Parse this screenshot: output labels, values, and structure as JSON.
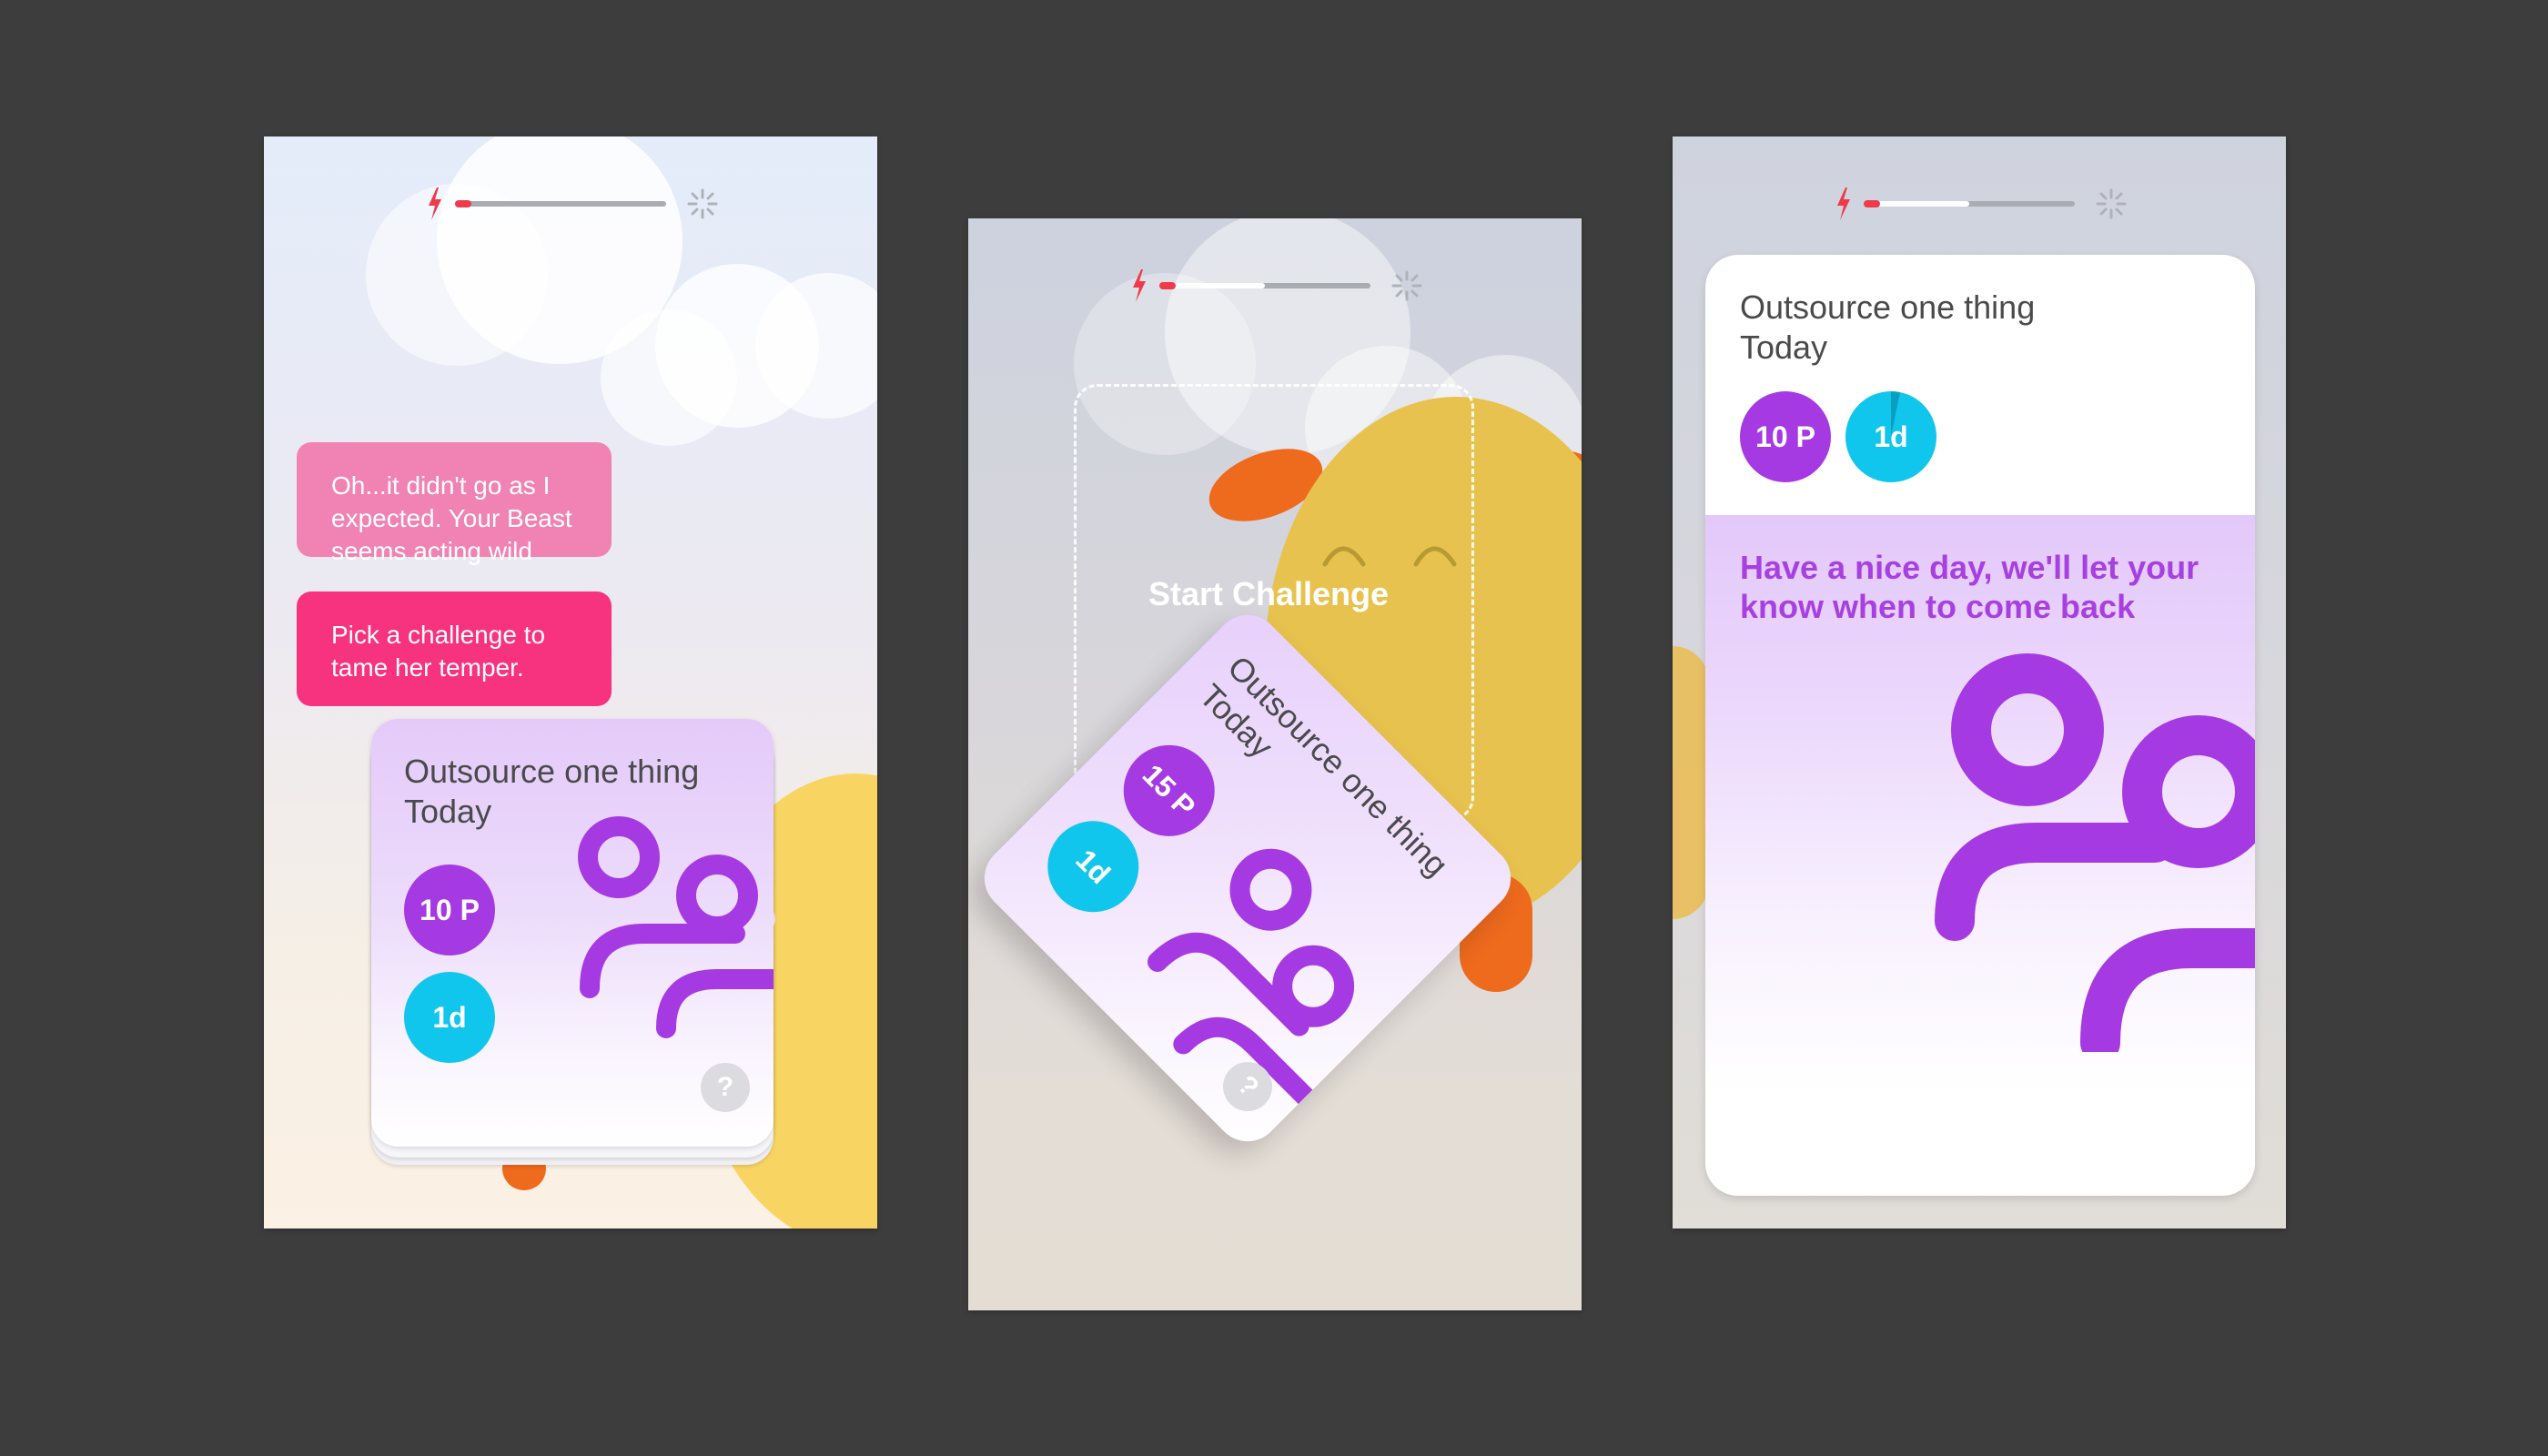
{
  "colors": {
    "background": "#3d3d3d",
    "bubble_light_pink": "#f083b3",
    "bubble_hot_pink": "#f7327f",
    "badge_purple": "#a53ae3",
    "badge_cyan": "#11c6ec",
    "text_purple": "#a740e0",
    "beast_yellow": "#e8c24e",
    "beast_orange": "#ee6a1d",
    "energy_red": "#ee3a4a"
  },
  "icons": [
    "bolt-icon",
    "sparkle-icon",
    "help-icon",
    "outsource-people-icon"
  ],
  "screens": [
    {
      "energy_level": 0.05,
      "messages": [
        "Oh...it didn't go as I expected. Your Beast seems acting wild",
        "Pick a challenge to tame her temper."
      ],
      "card": {
        "title": "Outsource one thing Today",
        "points": "10 P",
        "duration": "1d",
        "help": "?"
      }
    },
    {
      "energy_level": 0.5,
      "drop_zone_label": "Start Challenge",
      "card": {
        "title": "Outsource one thing Today",
        "points": "15 P",
        "duration": "1d",
        "help": "?"
      }
    },
    {
      "energy_level": 0.5,
      "card": {
        "title": "Outsource one thing Today",
        "points": "10 P",
        "duration": "1d",
        "message": "Have a nice day, we'll let your know when to come back"
      }
    }
  ]
}
